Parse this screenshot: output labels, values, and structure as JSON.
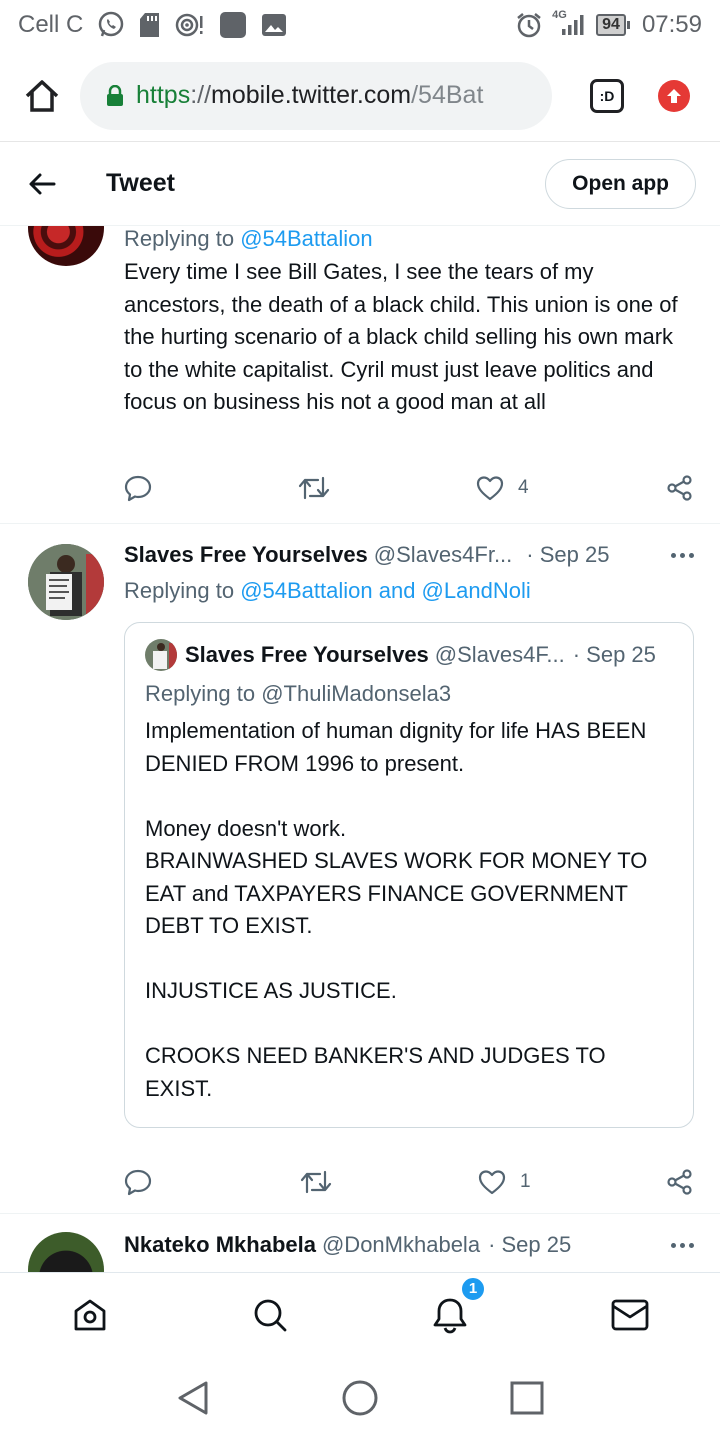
{
  "status_bar": {
    "carrier": "Cell C",
    "network": "4G",
    "battery": "94",
    "time": "07:59"
  },
  "browser": {
    "url_scheme": "https",
    "url_sep": "://",
    "url_host": "mobile.twitter.com",
    "url_path": "/54Bat",
    "tab_label": ":D"
  },
  "header": {
    "title": "Tweet",
    "open_app_label": "Open app"
  },
  "tweets": [
    {
      "replying_prefix": "Replying to",
      "replying_to": "@54Battalion",
      "text": "Every time I see Bill Gates, I see the tears of my ancestors, the death of a black child. This union is one of the hurting scenario of a black child selling his own mark to the white capitalist. Cyril must just leave politics and focus on business his not a good man at all",
      "likes": "4"
    },
    {
      "name": "Slaves Free Yourselves",
      "handle": "@Slaves4Fr...",
      "date": "· Sep 25",
      "replying_prefix": "Replying to",
      "replying_to": "@54Battalion and @LandNoli",
      "likes": "1",
      "quote": {
        "name": "Slaves Free Yourselves",
        "handle": "@Slaves4F...",
        "date": "· Sep 25",
        "replying_prefix": "Replying to",
        "replying_to": "@ThuliMadonsela3",
        "text": "Implementation of human dignity for life HAS BEEN DENIED FROM 1996 to present.\n\nMoney doesn't work.\nBRAINWASHED SLAVES WORK FOR MONEY TO EAT and TAXPAYERS FINANCE GOVERNMENT DEBT TO EXIST.\n\nINJUSTICE AS JUSTICE.\n\nCROOKS NEED BANKER'S AND JUDGES TO EXIST."
      }
    },
    {
      "name": "Nkateko Mkhabela",
      "handle": "@DonMkhabela",
      "date": "· Sep 25"
    }
  ],
  "bottom_nav": {
    "notifications_badge": "1"
  },
  "colors": {
    "twitter_blue": "#1d9bf0",
    "secondary_text": "#536471",
    "secure_green": "#188038",
    "update_red": "#e53935"
  },
  "icons": [
    "whatsapp-icon",
    "sd-card-icon",
    "hotspot-icon",
    "app-square-icon",
    "gallery-icon",
    "alarm-icon",
    "signal-icon",
    "home-icon",
    "lock-icon",
    "tabs-icon",
    "update-icon",
    "back-arrow-icon",
    "reply-icon",
    "retweet-icon",
    "like-icon",
    "share-icon",
    "more-icon",
    "search-icon",
    "bell-icon",
    "mail-icon"
  ]
}
